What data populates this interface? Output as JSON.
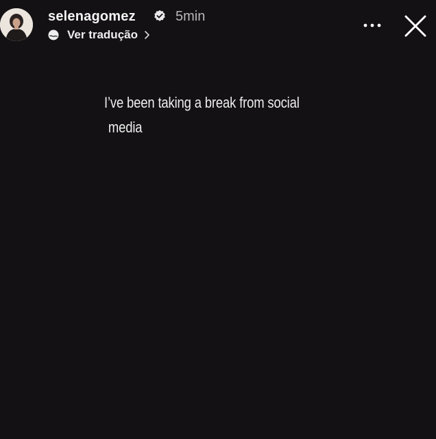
{
  "header": {
    "username": "selenagomez",
    "time": "5min",
    "translate_label": "Ver tradução",
    "icons": {
      "avatar": "profile-photo",
      "verified": "verified-badge-icon",
      "translate": "globe-icon",
      "translate_chevron": "chevron-right-icon",
      "more": "more-dots-icon",
      "close": "close-icon"
    }
  },
  "story": {
    "text_line1": "I’ve been taking a break from social",
    "text_line2": "media"
  },
  "colors": {
    "background": "#131113",
    "text": "#eeeeee",
    "muted": "#b9b7b9"
  }
}
